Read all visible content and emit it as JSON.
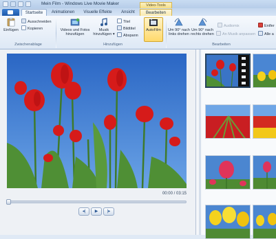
{
  "window": {
    "title": "Mein Film - Windows Live Movie Maker",
    "context_tab_header": "Video-Tools"
  },
  "tabs": [
    {
      "label": "Startseite",
      "active": true
    },
    {
      "label": "Animationen",
      "active": false
    },
    {
      "label": "Visuelle Effekte",
      "active": false
    },
    {
      "label": "Ansicht",
      "active": false
    },
    {
      "label": "Bearbeiten",
      "active": false,
      "contextual": true
    }
  ],
  "ribbon": {
    "clipboard": {
      "group_label": "Zwischenablage",
      "paste": "Einfügen",
      "cut": "Ausschneiden",
      "copy": "Kopieren"
    },
    "add": {
      "group_label": "Hinzufügen",
      "videos_photos_line1": "Videos und Fotos",
      "videos_photos_line2": "hinzufügen",
      "music_line1": "Musik",
      "music_line2": "hinzufügen ▾",
      "title": "Titel",
      "caption": "Bildtitel",
      "credits": "Abspann",
      "autofilm": "AutoFilm"
    },
    "edit": {
      "group_label": "Bearbeiten",
      "rotate_left_line1": "Um 90° nach",
      "rotate_left_line2": "links drehen",
      "rotate_right_line1": "Um 90° nach",
      "rotate_right_line2": "rechts drehen",
      "audiomix": "Audiomix",
      "fit_music": "An Musik anpassen",
      "remove": "Entfer",
      "select_all": "Alle a"
    }
  },
  "player": {
    "time": "00:00 / 03:15",
    "position_fraction": 0.0,
    "prev_icon": "◂|",
    "play_icon": "▶",
    "next_icon": "|▸"
  },
  "storyboard": {
    "clips": [
      {
        "name": "red tulips against sky",
        "selected": true
      },
      {
        "name": "yellow tulips"
      },
      {
        "name": "tulip field rows"
      },
      {
        "name": "red and yellow tulip field"
      },
      {
        "name": "pink tulip close-up"
      },
      {
        "name": "pink tulip"
      },
      {
        "name": "yellow tulips close-up"
      },
      {
        "name": "yellow tulips"
      }
    ]
  },
  "colors": {
    "ribbon_blue": "#dde8f5",
    "context_yellow": "#f5dd83",
    "app_button": "#1c58aa",
    "selection_border": "#27435f"
  }
}
